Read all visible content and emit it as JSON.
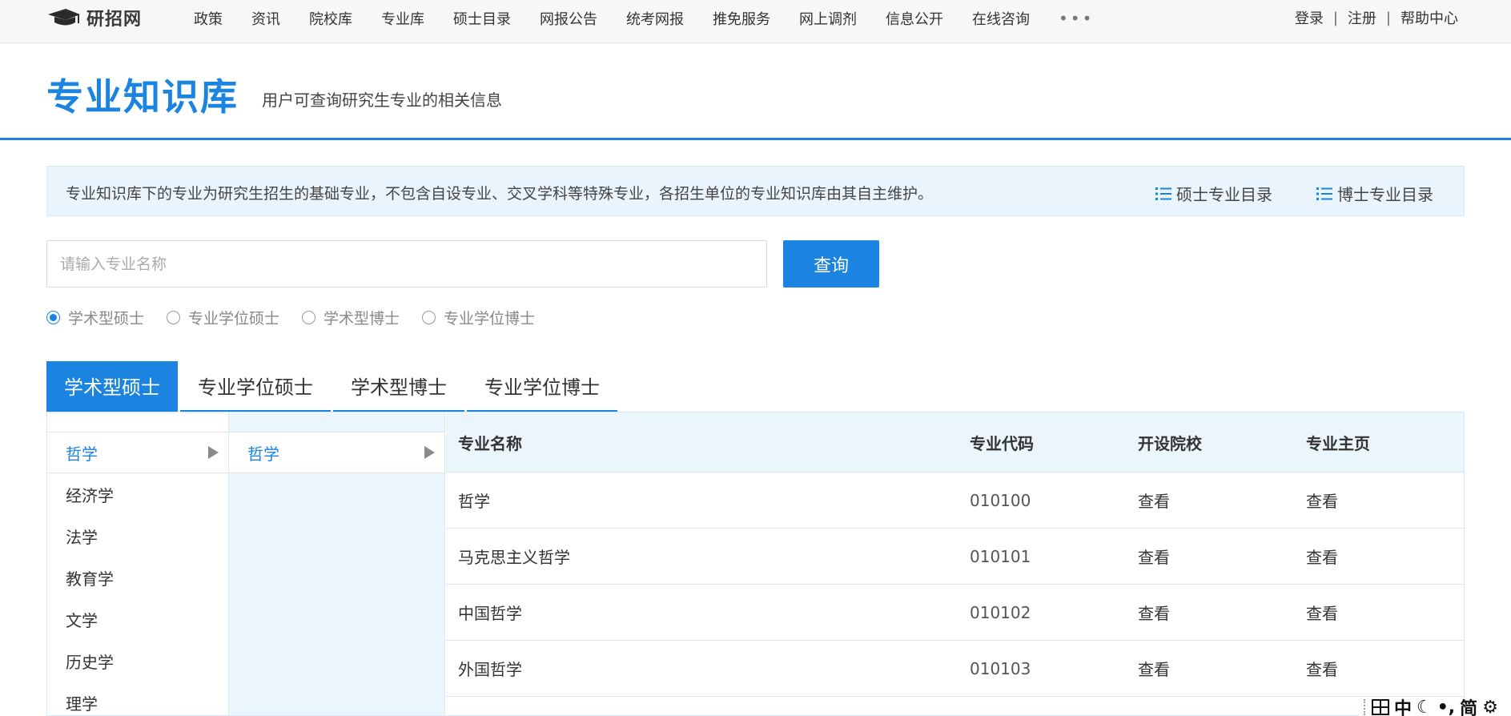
{
  "nav": {
    "logo_text": "研招网",
    "items": [
      "政策",
      "资讯",
      "院校库",
      "专业库",
      "硕士目录",
      "网报公告",
      "统考网报",
      "推免服务",
      "网上调剂",
      "信息公开",
      "在线咨询"
    ],
    "more": "•••",
    "login": "登录",
    "register": "注册",
    "help": "帮助中心",
    "sep": "|"
  },
  "header": {
    "title": "专业知识库",
    "subtitle": "用户可查询研究生专业的相关信息"
  },
  "notice": {
    "text": "专业知识库下的专业为研究生招生的基础专业，不包含自设专业、交叉学科等特殊专业，各招生单位的专业知识库由其自主维护。",
    "master_catalog": "硕士专业目录",
    "doctor_catalog": "博士专业目录"
  },
  "search": {
    "placeholder": "请输入专业名称",
    "value": "",
    "button": "查询"
  },
  "radios": {
    "options": [
      "学术型硕士",
      "专业学位硕士",
      "学术型博士",
      "专业学位博士"
    ],
    "selected": "学术型硕士"
  },
  "tabs": [
    "学术型硕士",
    "专业学位硕士",
    "学术型博士",
    "专业学位博士"
  ],
  "level1": [
    "哲学",
    "经济学",
    "法学",
    "教育学",
    "文学",
    "历史学",
    "理学"
  ],
  "level2": [
    "哲学"
  ],
  "table": {
    "headers": [
      "专业名称",
      "专业代码",
      "开设院校",
      "专业主页"
    ],
    "rows": [
      {
        "name": "哲学",
        "code": "010100",
        "schools": "查看",
        "home": "查看"
      },
      {
        "name": "马克思主义哲学",
        "code": "010101",
        "schools": "查看",
        "home": "查看"
      },
      {
        "name": "中国哲学",
        "code": "010102",
        "schools": "查看",
        "home": "查看"
      },
      {
        "name": "外国哲学",
        "code": "010103",
        "schools": "查看",
        "home": "查看"
      }
    ]
  },
  "ime": {
    "lang": "中",
    "mode": "简"
  },
  "colors": {
    "accent": "#1a84e0",
    "light_blue": "#eaf5fc"
  }
}
